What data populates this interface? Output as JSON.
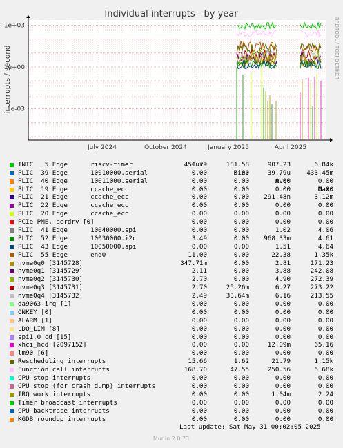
{
  "chart_data": {
    "type": "line",
    "title": "Individual interrupts - by year",
    "ylabel": "interrupts / second",
    "y_scale": "log",
    "y_ticks": [
      "1e-03",
      "1e+00",
      "1e+03"
    ],
    "x_ticks": [
      "July 2024",
      "October 2024",
      "January 2025",
      "April 2025"
    ],
    "side_label": "RRDTOOL / TOBI OETIKER",
    "columns": [
      "Cur:",
      "Min:",
      "Avg:",
      "Max:"
    ],
    "series": [
      {
        "name": "INTC   5 Edge      riscv-timer",
        "color": "#00cc00",
        "cur": "451.79",
        "min": "181.58",
        "avg": "907.23",
        "max": "6.84k"
      },
      {
        "name": "PLIC  39 Edge      10010000.serial",
        "color": "#0066b3",
        "cur": "0.00",
        "min": "0.00",
        "avg": "39.79u",
        "max": "433.45m"
      },
      {
        "name": "PLIC  40 Edge      10011000.serial",
        "color": "#ff8000",
        "cur": "0.00",
        "min": "0.00",
        "avg": "0.00",
        "max": "0.00"
      },
      {
        "name": "PLIC  19 Edge      ccache_ecc",
        "color": "#ffcc00",
        "cur": "0.00",
        "min": "0.00",
        "avg": "0.00",
        "max": "0.00"
      },
      {
        "name": "PLIC  21 Edge      ccache_ecc",
        "color": "#330099",
        "cur": "0.00",
        "min": "0.00",
        "avg": "291.48n",
        "max": "3.12m"
      },
      {
        "name": "PLIC  22 Edge      ccache_ecc",
        "color": "#990099",
        "cur": "0.00",
        "min": "0.00",
        "avg": "0.00",
        "max": "0.00"
      },
      {
        "name": "PLIC  20 Edge      ccache_ecc",
        "color": "#ccff00",
        "cur": "0.00",
        "min": "0.00",
        "avg": "0.00",
        "max": "0.00"
      },
      {
        "name": "PCIe PME, aerdrv [0]",
        "color": "#ff0000",
        "cur": "0.00",
        "min": "0.00",
        "avg": "0.00",
        "max": "0.00"
      },
      {
        "name": "PLIC  41 Edge      10040000.spi",
        "color": "#808080",
        "cur": "0.00",
        "min": "0.00",
        "avg": "1.02",
        "max": "4.06"
      },
      {
        "name": "PLIC  52 Edge      10030000.i2c",
        "color": "#008f00",
        "cur": "3.49",
        "min": "0.00",
        "avg": "968.33m",
        "max": "4.61"
      },
      {
        "name": "PLIC  43 Edge      10050000.spi",
        "color": "#00487d",
        "cur": "0.00",
        "min": "0.00",
        "avg": "1.51",
        "max": "4.64"
      },
      {
        "name": "PLIC  55 Edge      end0",
        "color": "#b35a00",
        "cur": "11.00",
        "min": "0.00",
        "avg": "22.38",
        "max": "1.35k"
      },
      {
        "name": "nvme0q0 [3145728]",
        "color": "#b38f00",
        "cur": "347.71m",
        "min": "0.00",
        "avg": "2.81",
        "max": "171.23"
      },
      {
        "name": "nvme0q1 [3145729]",
        "color": "#6b006b",
        "cur": "2.11",
        "min": "0.00",
        "avg": "3.88",
        "max": "242.08"
      },
      {
        "name": "nvme0q2 [3145730]",
        "color": "#8fb300",
        "cur": "2.70",
        "min": "0.00",
        "avg": "4.90",
        "max": "272.39"
      },
      {
        "name": "nvme0q3 [3145731]",
        "color": "#b30000",
        "cur": "2.70",
        "min": "25.26m",
        "avg": "6.27",
        "max": "273.22"
      },
      {
        "name": "nvme0q4 [3145732]",
        "color": "#bebebe",
        "cur": "2.49",
        "min": "33.64m",
        "avg": "6.16",
        "max": "213.55"
      },
      {
        "name": "da9063-irq [1]",
        "color": "#80ff80",
        "cur": "0.00",
        "min": "0.00",
        "avg": "0.00",
        "max": "0.00"
      },
      {
        "name": "ONKEY [0]",
        "color": "#80c9ff",
        "cur": "0.00",
        "min": "0.00",
        "avg": "0.00",
        "max": "0.00"
      },
      {
        "name": "ALARM [1]",
        "color": "#ffc080",
        "cur": "0.00",
        "min": "0.00",
        "avg": "0.00",
        "max": "0.00"
      },
      {
        "name": "LDO_LIM [8]",
        "color": "#ffe680",
        "cur": "0.00",
        "min": "0.00",
        "avg": "0.00",
        "max": "0.00"
      },
      {
        "name": "spi1.0 cd [15]",
        "color": "#aa80ff",
        "cur": "0.00",
        "min": "0.00",
        "avg": "0.00",
        "max": "0.00"
      },
      {
        "name": "xhci_hcd [2097152]",
        "color": "#ee00cc",
        "cur": "0.00",
        "min": "0.00",
        "avg": "12.09m",
        "max": "65.16"
      },
      {
        "name": "lm90 [6]",
        "color": "#ff8080",
        "cur": "0.00",
        "min": "0.00",
        "avg": "0.00",
        "max": "0.00"
      },
      {
        "name": "Rescheduling interrupts",
        "color": "#666600",
        "cur": "15.66",
        "min": "1.62",
        "avg": "21.79",
        "max": "1.15k"
      },
      {
        "name": "Function call interrupts",
        "color": "#ffbfff",
        "cur": "168.70",
        "min": "47.55",
        "avg": "250.56",
        "max": "6.68k"
      },
      {
        "name": "CPU stop interrupts",
        "color": "#00ffcc",
        "cur": "0.00",
        "min": "0.00",
        "avg": "0.00",
        "max": "0.00"
      },
      {
        "name": "CPU stop (for crash dump) interrupts",
        "color": "#cc6699",
        "cur": "0.00",
        "min": "0.00",
        "avg": "0.00",
        "max": "0.00"
      },
      {
        "name": "IRQ work interrupts",
        "color": "#999900",
        "cur": "0.00",
        "min": "0.00",
        "avg": "1.04m",
        "max": "2.24"
      },
      {
        "name": "Timer broadcast interrupts",
        "color": "#00cc00",
        "cur": "0.00",
        "min": "0.00",
        "avg": "0.00",
        "max": "0.00"
      },
      {
        "name": "CPU backtrace interrupts",
        "color": "#0066b3",
        "cur": "0.00",
        "min": "0.00",
        "avg": "0.00",
        "max": "0.00"
      },
      {
        "name": "KGDB roundup interrupts",
        "color": "#ff8000",
        "cur": "0.00",
        "min": "0.00",
        "avg": "0.00",
        "max": "0.00"
      }
    ],
    "last_update": "Last update: Sat May 31 00:02:05 2025",
    "generator": "Munin 2.0.73"
  }
}
